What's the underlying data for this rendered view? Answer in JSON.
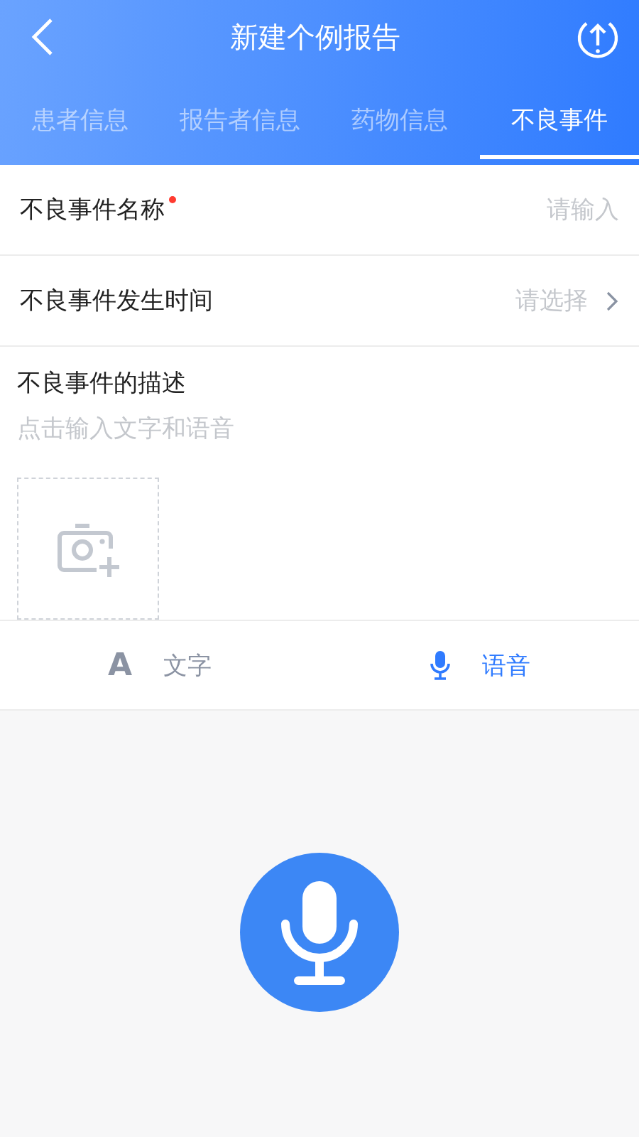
{
  "header": {
    "title": "新建个例报告"
  },
  "tabs": [
    {
      "label": "患者信息",
      "selected": false
    },
    {
      "label": "报告者信息",
      "selected": false
    },
    {
      "label": "药物信息",
      "selected": false
    },
    {
      "label": "不良事件",
      "selected": true
    }
  ],
  "fields": [
    {
      "kind": "input",
      "label": "不良事件名称",
      "required": true,
      "placeholder": "请输入"
    },
    {
      "kind": "select",
      "label": "不良事件发生时间",
      "required": false,
      "placeholder": "请选择"
    }
  ],
  "description": {
    "label": "不良事件的描述",
    "placeholder": "点击输入文字和语音"
  },
  "modes": [
    {
      "kind": "text",
      "icon": "A",
      "label": "文字",
      "selected": false
    },
    {
      "kind": "voice",
      "label": "语音",
      "selected": true
    }
  ]
}
